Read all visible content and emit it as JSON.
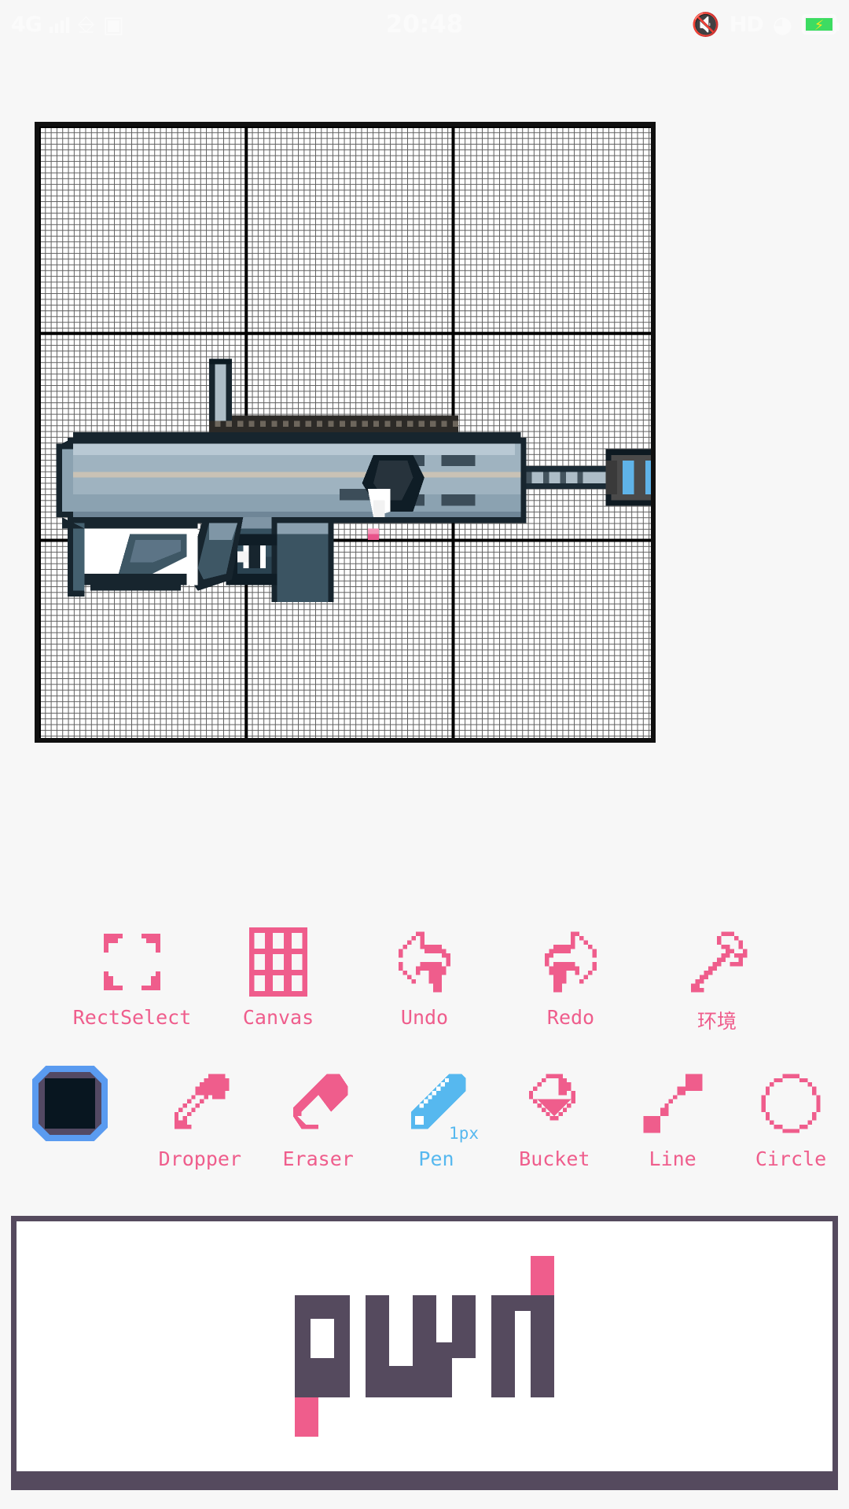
{
  "status_bar": {
    "network_type": "4G",
    "signal_icon": "signal-bars-icon",
    "carrier_glyph_1": "sim-card-icon",
    "carrier_glyph_2": "sd-card-icon",
    "clock": "20:48",
    "mute_icon": "mute-icon",
    "hd_label": "HD",
    "wifi_icon": "wifi-icon",
    "battery_icon": "battery-charging-icon",
    "battery_color": "#3ddc62",
    "bolt_color": "#ffe81c"
  },
  "canvas": {
    "name": "pixel-art-canvas",
    "grid_cols": 108,
    "grid_rows": 108,
    "major_block": 36,
    "grid_line_color": "#555555",
    "major_line_color": "#000000",
    "background": "#ffffff",
    "artwork_title": "rifle-pixel-art"
  },
  "palette": {
    "current_color": "#081620",
    "selection_ring": "#5a9bf0",
    "selection_mid": "#534963"
  },
  "theme": {
    "accent_pink": "#ef5d8c",
    "accent_blue": "#56b8ef",
    "panel_dark": "#554a5e",
    "page_bg": "#f7f7f7"
  },
  "toolbar_row1": [
    {
      "id": "rect-select",
      "label": "RectSelect",
      "icon": "rect-select-icon",
      "active": false
    },
    {
      "id": "canvas",
      "label": "Canvas",
      "icon": "grid-icon",
      "active": false
    },
    {
      "id": "undo",
      "label": "Undo",
      "icon": "undo-arrow-icon",
      "active": false
    },
    {
      "id": "redo",
      "label": "Redo",
      "icon": "redo-arrow-icon",
      "active": false
    },
    {
      "id": "settings",
      "label": "环境",
      "icon": "wrench-icon",
      "active": false
    }
  ],
  "toolbar_row2": [
    {
      "id": "color-swatch",
      "label": "",
      "icon": "color-swatch-icon",
      "active": false,
      "size": ""
    },
    {
      "id": "dropper",
      "label": "Dropper",
      "icon": "eyedropper-icon",
      "active": false,
      "size": ""
    },
    {
      "id": "eraser",
      "label": "Eraser",
      "icon": "eraser-icon",
      "active": false,
      "size": ""
    },
    {
      "id": "pen",
      "label": "Pen",
      "icon": "pencil-icon",
      "active": true,
      "size": "1px"
    },
    {
      "id": "bucket",
      "label": "Bucket",
      "icon": "paint-bucket-icon",
      "active": false,
      "size": ""
    },
    {
      "id": "line",
      "label": "Line",
      "icon": "line-tool-icon",
      "active": false,
      "size": ""
    },
    {
      "id": "circle",
      "label": "Circle",
      "icon": "circle-tool-icon",
      "active": false,
      "size": ""
    }
  ],
  "push_panel": {
    "name": "push-banner",
    "logo_text": "push",
    "logo_color": "#554a5e",
    "accent_color": "#ef5d8c",
    "border_color": "#554a5e",
    "background": "#ffffff"
  }
}
